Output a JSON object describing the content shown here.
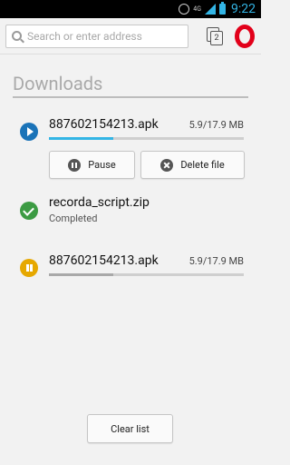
{
  "statusbar": {
    "network": "4G",
    "time": "9:22"
  },
  "toolbar": {
    "address_placeholder": "Search or enter address",
    "tab_count": "2"
  },
  "page": {
    "title": "Downloads"
  },
  "downloads": [
    {
      "name": "887602154213.apk",
      "size": "5.9/17.9 MB",
      "status": "downloading",
      "progress": 0.33,
      "actions": {
        "pause_label": "Pause",
        "delete_label": "Delete file"
      }
    },
    {
      "name": "recorda_script.zip",
      "status_text": "Completed",
      "status": "completed"
    },
    {
      "name": "887602154213.apk",
      "size": "5.9/17.9 MB",
      "status": "paused",
      "progress": 0.33
    }
  ],
  "footer": {
    "clear_label": "Clear list"
  },
  "colors": {
    "accent_blue": "#1a73b8",
    "progress_blue": "#33b5e5",
    "done_green": "#3c9b43",
    "paused_orange": "#e6a800",
    "opera_red": "#e2001a"
  }
}
